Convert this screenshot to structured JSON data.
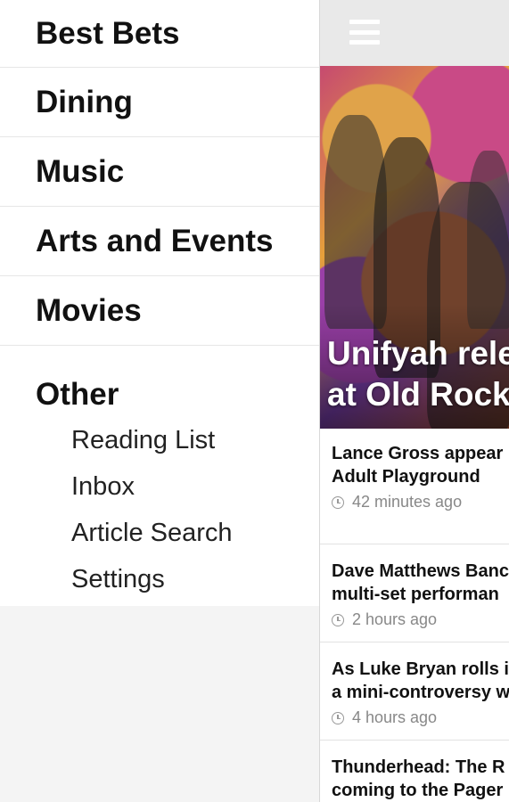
{
  "drawer": {
    "nav_items": [
      "Best Bets",
      "Dining",
      "Music",
      "Arts and Events",
      "Movies"
    ],
    "other_label": "Other",
    "sub_items": [
      "Reading List",
      "Inbox",
      "Article Search",
      "Settings"
    ]
  },
  "main": {
    "menu_icon": "hamburger-menu-icon",
    "hero": {
      "title_line1": "Unifyah rele",
      "title_line2": "at Old Rock"
    },
    "articles": [
      {
        "line1": "Lance Gross appear",
        "line2": "Adult Playground",
        "time": "42 minutes ago"
      },
      {
        "line1": "Dave Matthews Banc",
        "line2": "multi-set performan",
        "time": "2 hours ago"
      },
      {
        "line1": "As Luke Bryan rolls i",
        "line2": "a mini-controversy w",
        "time": "4 hours ago"
      },
      {
        "line1": "Thunderhead: The R",
        "line2": "coming to the Pager"
      }
    ]
  },
  "colors": {
    "appbar": "#e9e9e9",
    "drawer_footer": "#f4f4f4",
    "text": "#111111",
    "meta": "#888888"
  }
}
